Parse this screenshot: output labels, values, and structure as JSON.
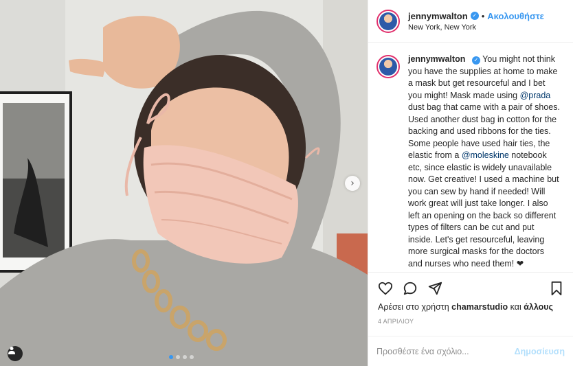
{
  "post": {
    "username": "jennymwalton",
    "follow_label": "Ακολουθήστε",
    "location": "New York, New York",
    "caption": {
      "part1": "You might not think you have the supplies at home to make a mask but get resourceful and I bet you might! Mask made using ",
      "mention1": "@prada",
      "part2": " dust bag that came with a pair of shoes. Used another dust bag in cotton for the backing and used ribbons for the ties. Some people have used hair ties, the elastic from a ",
      "mention2": "@moleskine",
      "part3": " notebook etc, since elastic is widely unavailable now. Get creative! I used a machine but you can sew by hand if needed! Will work great will just take longer. I also left an opening on the back so different types of filters can be cut and put inside. Let's get resourceful, leaving more surgical masks for the doctors and nurses who need them! ❤"
    },
    "likes": {
      "prefix": "Αρέσει στο χρήστη ",
      "user": "chamarstudio",
      "middle": " και ",
      "others": "άλλους"
    },
    "date": "4 ΑΠΡΙΛΙΟΥ",
    "comment_placeholder": "Προσθέστε ένα σχόλιο...",
    "post_label": "Δημοσίευση"
  },
  "carousel": {
    "slide_count": 4,
    "active_index": 0
  },
  "icons": {
    "like": "heart-icon",
    "comment": "comment-icon",
    "share": "share-icon",
    "save": "bookmark-icon",
    "verified": "verified-badge-icon",
    "next": "chevron-right-icon",
    "tag": "user-tag-icon"
  },
  "colors": {
    "accent": "#3897f0",
    "mask": "#f2c7b8",
    "sweater": "#a9a8a4"
  }
}
